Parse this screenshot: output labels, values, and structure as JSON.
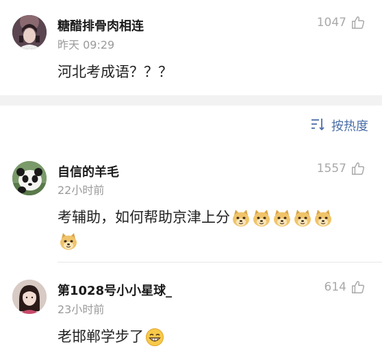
{
  "comments": [
    {
      "username": "糖醋排骨肉相连",
      "time": "昨天 09:29",
      "likes": "1047",
      "text": "河北考成语？？？",
      "avatar": "avatar-dark-portrait"
    },
    {
      "username": "自信的羊毛",
      "time": "22小时前",
      "likes": "1557",
      "text_line1": "考辅助，如何帮助京津上分",
      "avatar": "avatar-panda",
      "emojis": [
        "doge-emoji",
        "doge-emoji",
        "doge-emoji",
        "doge-emoji",
        "doge-emoji",
        "doge-emoji"
      ]
    },
    {
      "username": "第1028号小小星球_",
      "time": "23小时前",
      "likes": "614",
      "text": "老邯郸学步了",
      "avatar": "avatar-girl",
      "emojis": [
        "grin-emoji"
      ]
    }
  ],
  "sort": {
    "label": "按热度",
    "icon": "sort-icon"
  },
  "colors": {
    "link": "#4a6ea8",
    "muted": "#a8a8a8",
    "band": "#f2f2f2"
  }
}
